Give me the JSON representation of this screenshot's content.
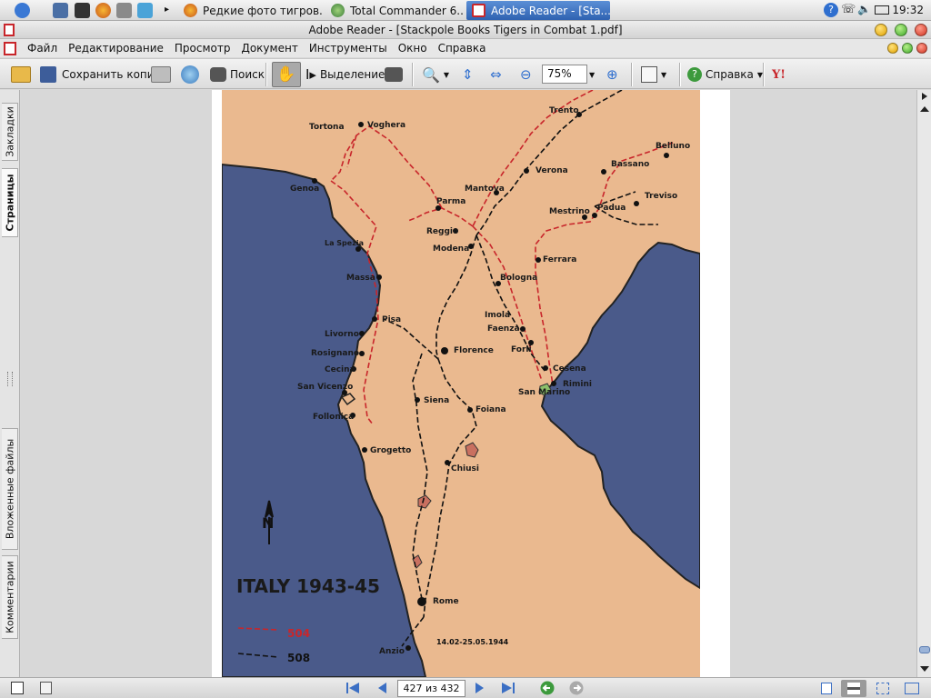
{
  "taskbar": {
    "tasks": [
      {
        "label": "Редкие фото тигров..."
      },
      {
        "label": "Total Commander 6...."
      },
      {
        "label": "Adobe Reader - [Sta..."
      }
    ],
    "clock": "19:32"
  },
  "window": {
    "title": "Adobe Reader - [Stackpole Books Tigers in Combat 1.pdf]"
  },
  "menu": {
    "items": [
      "Файл",
      "Редактирование",
      "Просмотр",
      "Документ",
      "Инструменты",
      "Окно",
      "Справка"
    ]
  },
  "toolbar": {
    "save_copy": "Сохранить копию",
    "search": "Поиск",
    "select": "Выделение",
    "zoom_value": "75%",
    "help": "Справка"
  },
  "left_tabs": {
    "bookmarks": "Закладки",
    "pages": "Страницы",
    "attachments": "Вложенные файлы",
    "comments": "Комментарии"
  },
  "status": {
    "page_indicator": "427 из 432"
  },
  "map": {
    "title": "ITALY 1943-45",
    "north": "N",
    "legend": [
      {
        "label": "504",
        "color": "#c8262b"
      },
      {
        "label": "508",
        "color": "#111111"
      }
    ],
    "date_note": "14.02-25.05.1944",
    "colors": {
      "land": "#eab98f",
      "sea": "#4a5a8a",
      "area": "#c97060",
      "green": "#8bbf6a"
    },
    "cities": [
      {
        "name": "Tortona"
      },
      {
        "name": "Voghera"
      },
      {
        "name": "Trento"
      },
      {
        "name": "Belluno"
      },
      {
        "name": "Genoa"
      },
      {
        "name": "Verona"
      },
      {
        "name": "Bassano"
      },
      {
        "name": "Mantova"
      },
      {
        "name": "Treviso"
      },
      {
        "name": "Parma"
      },
      {
        "name": "Mestrino"
      },
      {
        "name": "Padua"
      },
      {
        "name": "La Spezia"
      },
      {
        "name": "Reggio"
      },
      {
        "name": "Modena"
      },
      {
        "name": "Ferrara"
      },
      {
        "name": "Massa"
      },
      {
        "name": "Bologna"
      },
      {
        "name": "Imola"
      },
      {
        "name": "Pisa"
      },
      {
        "name": "Faenza"
      },
      {
        "name": "Livorno"
      },
      {
        "name": "Forli"
      },
      {
        "name": "Florence"
      },
      {
        "name": "Rosignano"
      },
      {
        "name": "Cecina"
      },
      {
        "name": "Cesena"
      },
      {
        "name": "San Vicenzo"
      },
      {
        "name": "Siena"
      },
      {
        "name": "San Marino"
      },
      {
        "name": "Rimini"
      },
      {
        "name": "Follonica"
      },
      {
        "name": "Foiana"
      },
      {
        "name": "Grogetto"
      },
      {
        "name": "Chiusi"
      },
      {
        "name": "Rome"
      },
      {
        "name": "Anzio"
      }
    ]
  }
}
